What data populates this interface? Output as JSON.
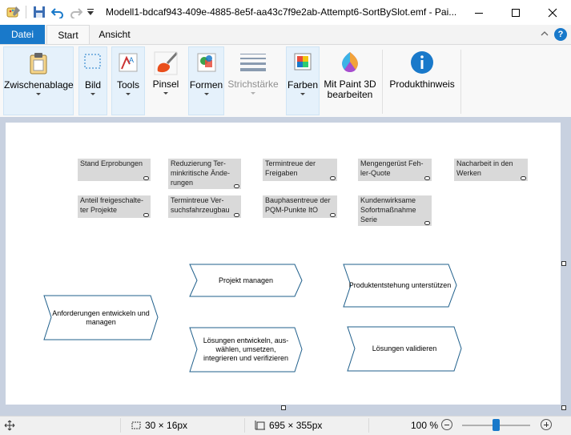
{
  "window": {
    "title": "Modell1-bdcaf943-409e-4885-8e5f-aa43c7f9e2ab-Attempt6-SortBySlot.emf - Pai...",
    "quick_access_icons": [
      "paint-app-icon",
      "save-icon",
      "undo-icon",
      "redo-icon",
      "customize-dropdown-icon"
    ],
    "controls": [
      "minimize-icon",
      "maximize-icon",
      "close-icon"
    ]
  },
  "tabs": {
    "file": "Datei",
    "home": "Start",
    "view": "Ansicht"
  },
  "ribbon": {
    "clipboard": "Zwischenablage",
    "image": "Bild",
    "tools": "Tools",
    "brush": "Pinsel",
    "shapes": "Formen",
    "stroke": "Strichstärke",
    "colors": "Farben",
    "paint3d_line1": "Mit Paint 3D",
    "paint3d_line2": "bearbeiten",
    "product_alert": "Produkthinweis",
    "accent": "#1979ca"
  },
  "canvas": {
    "kpis": [
      {
        "text": "Stand Erprobungen"
      },
      {
        "text": "Reduzierung Ter-minkritische Ände-rungen"
      },
      {
        "text": "Termintreue der Freigaben"
      },
      {
        "text": "Mengengerüst Feh-ler-Quote"
      },
      {
        "text": "Nacharbeit in den Werken"
      },
      {
        "text": "Anteil freigeschalte-ter Projekte"
      },
      {
        "text": "Termintreue Ver-suchsfahrzeugbau"
      },
      {
        "text": "Bauphasentreue der PQM-Punkte ItO"
      },
      {
        "text": "Kundenwirksame Sofortmaßnahme Serie"
      }
    ],
    "processes": [
      {
        "text": "Projekt managen"
      },
      {
        "text": "Produktentstehung unterstützen"
      },
      {
        "text": "Anforderungen entwickeln und managen"
      },
      {
        "text": "Lösungen entwickeln, aus-wählen, umsetzen, integrieren und verifizieren"
      },
      {
        "text": "Lösungen validieren"
      }
    ],
    "chevron_stroke": "#1f5f8b"
  },
  "status": {
    "selection_size": "30 × 16px",
    "image_size": "695 × 355px",
    "zoom": "100 %"
  }
}
